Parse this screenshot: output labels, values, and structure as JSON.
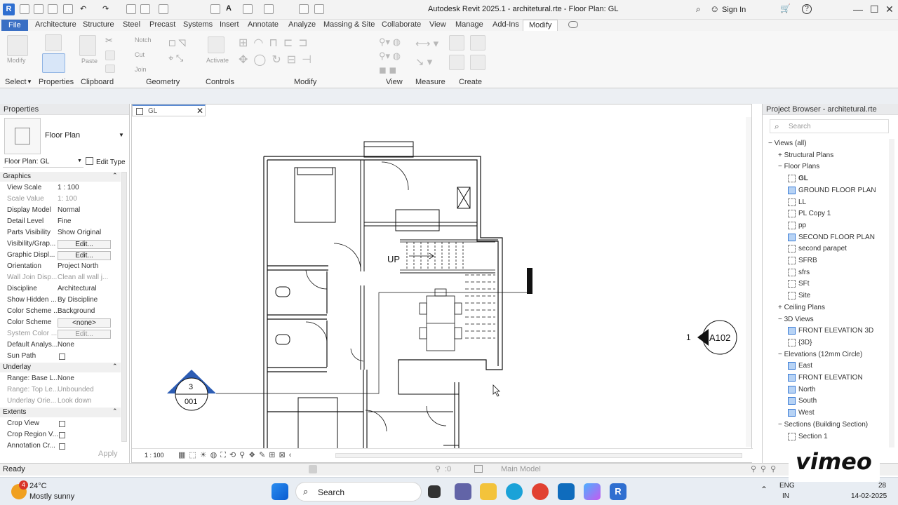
{
  "app": {
    "title": "Autodesk Revit 2025.1 - architetural.rte - Floor Plan: GL",
    "sign_in": "Sign In"
  },
  "menu": [
    "File",
    "Architecture",
    "Structure",
    "Steel",
    "Precast",
    "Systems",
    "Insert",
    "Annotate",
    "Analyze",
    "Massing & Site",
    "Collaborate",
    "View",
    "Manage",
    "Add-Ins",
    "Modify"
  ],
  "ribbon": {
    "panels": [
      "Select",
      "Properties",
      "Clipboard",
      "Geometry",
      "Controls",
      "Modify",
      "View",
      "Measure",
      "Create"
    ],
    "tools": [
      "Modify",
      "Paste",
      "Notch",
      "Cut",
      "Join",
      "Activate"
    ]
  },
  "properties": {
    "header": "Properties",
    "type": "Floor Plan",
    "selector": "Floor Plan: GL",
    "edit_type": "Edit Type",
    "graphics_section": "Graphics",
    "rows": [
      {
        "label": "View Scale",
        "value": "1 : 100",
        "dim": false
      },
      {
        "label": "Scale Value",
        "value": "1: 100",
        "dim": true
      },
      {
        "label": "Display Model",
        "value": "Normal",
        "dim": false
      },
      {
        "label": "Detail Level",
        "value": "Fine",
        "dim": false
      },
      {
        "label": "Parts Visibility",
        "value": "Show Original",
        "dim": false
      },
      {
        "label": "Visibility/Grap...",
        "value": "Edit...",
        "dim": false,
        "button": true
      },
      {
        "label": "Graphic Displ...",
        "value": "Edit...",
        "dim": false,
        "button": true
      },
      {
        "label": "Orientation",
        "value": "Project North",
        "dim": false
      },
      {
        "label": "Wall Join Disp...",
        "value": "Clean all wall j...",
        "dim": true
      },
      {
        "label": "Discipline",
        "value": "Architectural",
        "dim": false
      },
      {
        "label": "Show Hidden ...",
        "value": "By Discipline",
        "dim": false
      },
      {
        "label": "Color Scheme ...",
        "value": "Background",
        "dim": false
      },
      {
        "label": "Color Scheme",
        "value": "<none>",
        "dim": false,
        "button": true
      },
      {
        "label": "System Color ...",
        "value": "Edit...",
        "dim": true,
        "button": true
      },
      {
        "label": "Default Analys...",
        "value": "None",
        "dim": false
      },
      {
        "label": "Sun Path",
        "value": "",
        "dim": false,
        "checkbox": true
      }
    ],
    "underlay_section": "Underlay",
    "underlay_rows": [
      {
        "label": "Range: Base L...",
        "value": "None",
        "dim": false
      },
      {
        "label": "Range: Top Le...",
        "value": "Unbounded",
        "dim": true
      },
      {
        "label": "Underlay Orie...",
        "value": "Look down",
        "dim": true
      }
    ],
    "extents_section": "Extents",
    "extents_rows": [
      {
        "label": "Crop View",
        "value": "",
        "checkbox": true
      },
      {
        "label": "Crop Region V...",
        "value": "",
        "checkbox": true
      },
      {
        "label": "Annotation Cr...",
        "value": "",
        "checkbox": true
      }
    ],
    "apply": "Apply"
  },
  "view_tab": {
    "label": "GL",
    "scale": "1 : 100"
  },
  "plan": {
    "stair_label": "UP",
    "section_number": "3",
    "section_sheet": "001",
    "elev_number": "1",
    "elev_sheet": "A102"
  },
  "browser": {
    "header": "Project Browser - architetural.rte",
    "search": "Search",
    "items": [
      {
        "text": "Views (all)",
        "indent": 0,
        "kind": "root"
      },
      {
        "text": "Structural Plans",
        "indent": 1,
        "kind": "plus"
      },
      {
        "text": "Floor Plans",
        "indent": 1,
        "kind": "minus"
      },
      {
        "text": "GL",
        "indent": 2,
        "kind": "view",
        "bold": true
      },
      {
        "text": "GROUND FLOOR PLAN",
        "indent": 2,
        "kind": "viewblue"
      },
      {
        "text": "LL",
        "indent": 2,
        "kind": "view"
      },
      {
        "text": "PL Copy 1",
        "indent": 2,
        "kind": "view"
      },
      {
        "text": "pp",
        "indent": 2,
        "kind": "view"
      },
      {
        "text": "SECOND FLOOR PLAN",
        "indent": 2,
        "kind": "viewblue"
      },
      {
        "text": "second parapet",
        "indent": 2,
        "kind": "view"
      },
      {
        "text": "SFRB",
        "indent": 2,
        "kind": "view"
      },
      {
        "text": "sfrs",
        "indent": 2,
        "kind": "view"
      },
      {
        "text": "SFt",
        "indent": 2,
        "kind": "view"
      },
      {
        "text": "Site",
        "indent": 2,
        "kind": "view"
      },
      {
        "text": "Ceiling Plans",
        "indent": 1,
        "kind": "plus"
      },
      {
        "text": "3D Views",
        "indent": 1,
        "kind": "minus"
      },
      {
        "text": "FRONT ELEVATION 3D",
        "indent": 2,
        "kind": "viewblue"
      },
      {
        "text": "{3D}",
        "indent": 2,
        "kind": "view"
      },
      {
        "text": "Elevations (12mm Circle)",
        "indent": 1,
        "kind": "minus"
      },
      {
        "text": "East",
        "indent": 2,
        "kind": "viewblue"
      },
      {
        "text": "FRONT ELEVATION",
        "indent": 2,
        "kind": "viewblue"
      },
      {
        "text": "North",
        "indent": 2,
        "kind": "viewblue"
      },
      {
        "text": "South",
        "indent": 2,
        "kind": "viewblue"
      },
      {
        "text": "West",
        "indent": 2,
        "kind": "viewblue"
      },
      {
        "text": "Sections (Building Section)",
        "indent": 1,
        "kind": "minus"
      },
      {
        "text": "Section 1",
        "indent": 2,
        "kind": "view"
      }
    ]
  },
  "status": {
    "ready": "Ready",
    "workset": ":0",
    "model": "Main Model"
  },
  "taskbar": {
    "temp": "24°C",
    "weather": "Mostly sunny",
    "badge": "4",
    "search": "Search",
    "lang1": "ENG",
    "lang2": "IN",
    "time": "28",
    "date": "14-02-2025"
  },
  "watermark": "vimeo"
}
